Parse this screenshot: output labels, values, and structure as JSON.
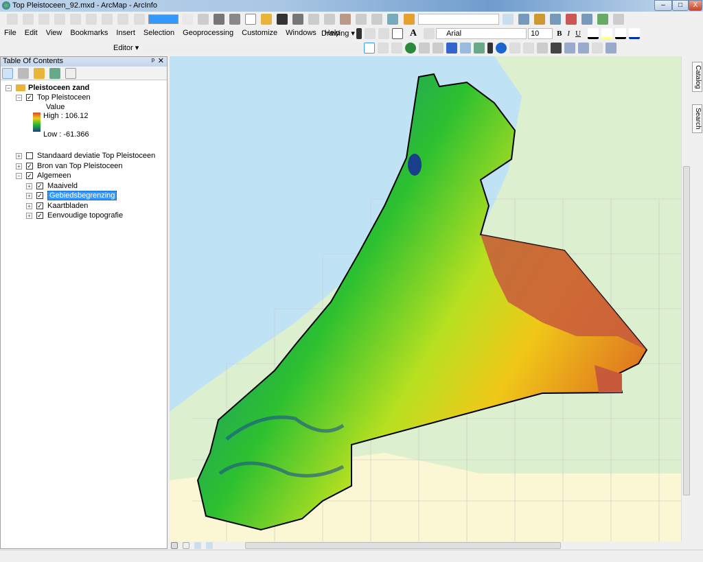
{
  "window": {
    "title": "Top Pleistoceen_92.mxd - ArcMap - ArcInfo",
    "minimize": "–",
    "maximize": "□",
    "close": "X"
  },
  "toolbar": {
    "scale_value": "",
    "font_name": "Arial",
    "font_size": "10",
    "bold": "B",
    "italic": "I",
    "underline": "U",
    "editor_label": "Editor ▾",
    "drawing_label": "Drawing ▾"
  },
  "menu": [
    "File",
    "Edit",
    "View",
    "Bookmarks",
    "Insert",
    "Selection",
    "Geoprocessing",
    "Customize",
    "Windows",
    "Help"
  ],
  "toc": {
    "title": "Table Of Contents",
    "pin": "ᵖ",
    "close": "✕",
    "root": "Pleistoceen zand",
    "layer": "Top Pleistoceen",
    "legend": {
      "label": "Value",
      "high": "High : 106.12",
      "low": "Low : -61.366",
      "colors": [
        "#d24a2c",
        "#f0c818",
        "#2ec030",
        "#1a3f8a"
      ]
    },
    "items": [
      {
        "label": "Standaard  deviatie Top Pleistoceen",
        "checked": false,
        "level": 1
      },
      {
        "label": "Bron van Top Pleistoceen",
        "checked": true,
        "level": 1
      },
      {
        "label": "Algemeen",
        "checked": true,
        "level": 1,
        "expanded": true
      },
      {
        "label": "Maaiveld",
        "checked": true,
        "level": 2
      },
      {
        "label": "Gebiedsbegrenzing",
        "checked": true,
        "level": 2,
        "selected": true
      },
      {
        "label": "Kaartbladen",
        "checked": true,
        "level": 2
      },
      {
        "label": "Eenvoudige topografie",
        "checked": true,
        "level": 2
      }
    ]
  },
  "side_tabs": [
    "Catalog",
    "Search"
  ],
  "colors": {
    "sea": "#bfe3f5",
    "land_east": "#dcefcf",
    "land_south": "#fbf6d3",
    "selection": "#3399ff"
  }
}
